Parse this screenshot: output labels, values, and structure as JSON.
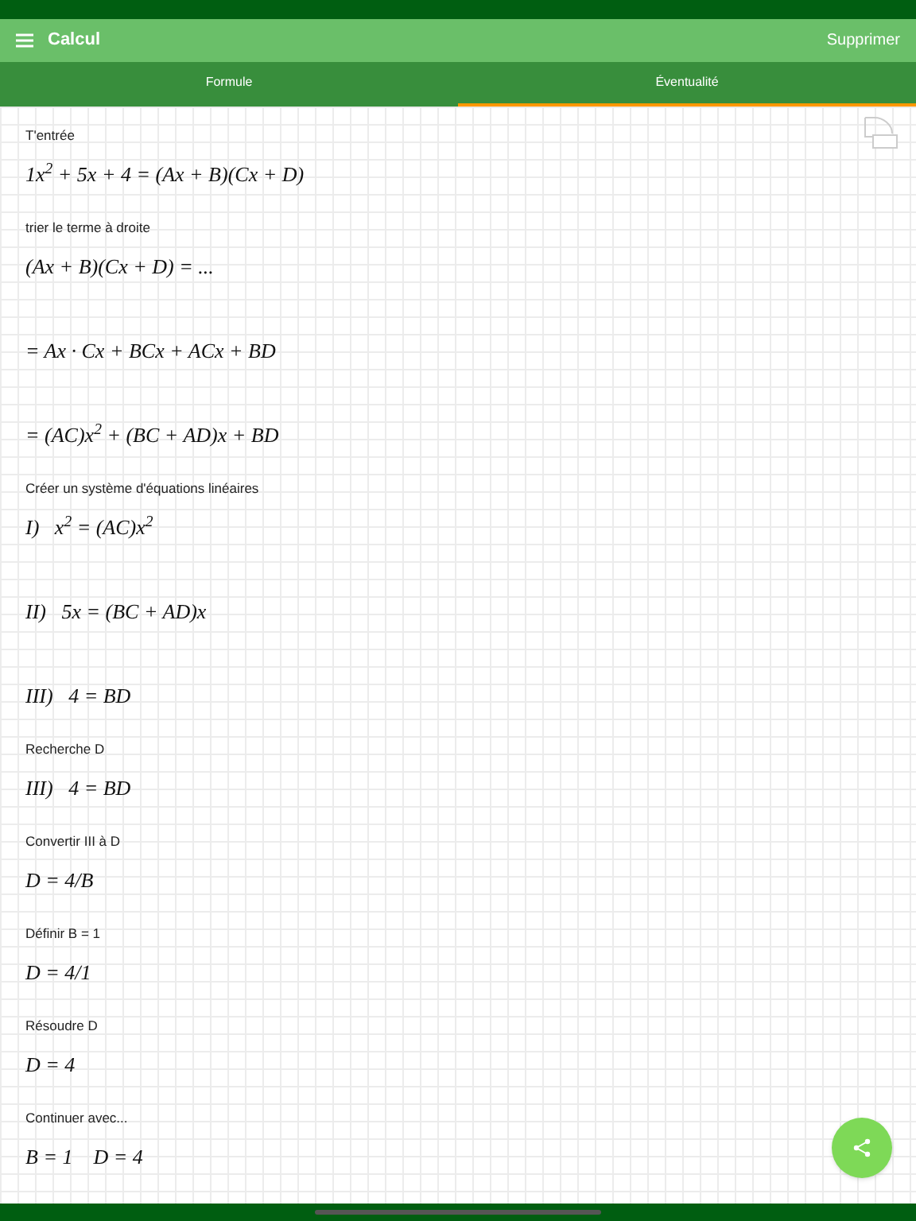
{
  "header": {
    "title": "Calcul",
    "action": "Supprimer"
  },
  "tabs": [
    {
      "label": "Formule",
      "selected": false
    },
    {
      "label": "Éventualité",
      "selected": true
    }
  ],
  "steps": [
    {
      "kind": "label",
      "text": "T'entrée"
    },
    {
      "kind": "formula",
      "text": "1x$^{2}$ + 5x + 4 = (Ax + B)(Cx + D)"
    },
    {
      "kind": "label",
      "text": "trier le terme à droite"
    },
    {
      "kind": "formula",
      "text": "(Ax + B)(Cx + D) = ..."
    },
    {
      "kind": "formula",
      "text": "= Ax · Cx + BCx + ACx + BD"
    },
    {
      "kind": "formula",
      "text": "= (AC)x$^{2}$ + (BC + AD)x + BD"
    },
    {
      "kind": "label",
      "text": "Créer un système d'équations linéaires"
    },
    {
      "kind": "formula",
      "text": "I)   x$^{2}$ = (AC)x$^{2}$"
    },
    {
      "kind": "formula",
      "text": "II)   5x = (BC + AD)x"
    },
    {
      "kind": "formula",
      "text": "III)   4 = BD"
    },
    {
      "kind": "label",
      "text": "Recherche D"
    },
    {
      "kind": "formula",
      "text": "III)   4 = BD"
    },
    {
      "kind": "label",
      "text": "Convertir III à D"
    },
    {
      "kind": "formula",
      "text": "D = 4/B"
    },
    {
      "kind": "label",
      "text": "Définir B = 1"
    },
    {
      "kind": "formula",
      "text": "D = 4/1"
    },
    {
      "kind": "label",
      "text": "Résoudre D"
    },
    {
      "kind": "formula",
      "text": "D = 4"
    },
    {
      "kind": "label",
      "text": "Continuer avec..."
    },
    {
      "kind": "formula",
      "text": "B = 1    D = 4"
    }
  ]
}
